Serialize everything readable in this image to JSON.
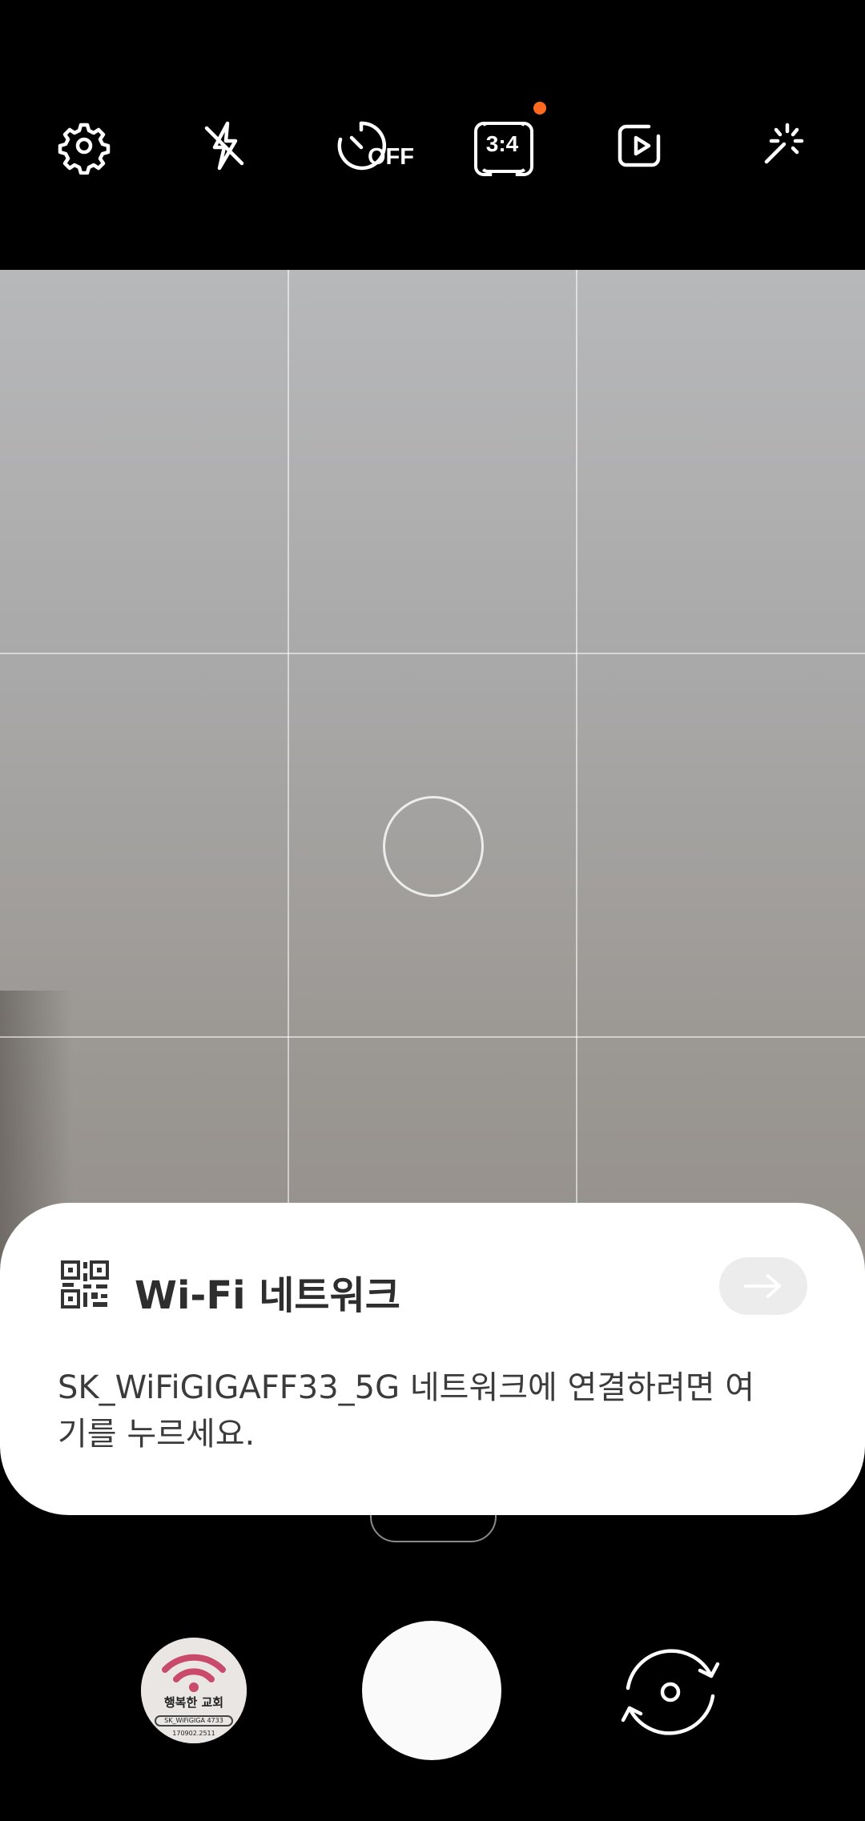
{
  "topbar": {
    "settings_icon": "gear-icon",
    "flash_icon": "flash-off-icon",
    "timer_label": "OFF",
    "ratio_label": "3:4",
    "motion_icon": "motion-photo-icon",
    "filter_icon": "magic-effect-icon",
    "notification_dot_color": "#ff6a1f"
  },
  "viewfinder": {
    "grid": "3x3",
    "focus_indicator": "circle"
  },
  "wifi_sheet": {
    "title": "Wi-Fi 네트워크",
    "message": "SK_WiFiGIGAFF33_5G 네트워크에 연결하려면 여기를 누르세요.",
    "icon": "qr-code-icon",
    "action_icon": "arrow-right-icon"
  },
  "bottom": {
    "thumbnail_icon": "gallery-thumbnail",
    "thumbnail_text": "행복한 교회",
    "thumbnail_ssid": "SK_WiFiGIGA 4733",
    "thumbnail_number": "170902.2511",
    "shutter": "shutter-button",
    "switch_icon": "switch-camera-icon"
  }
}
